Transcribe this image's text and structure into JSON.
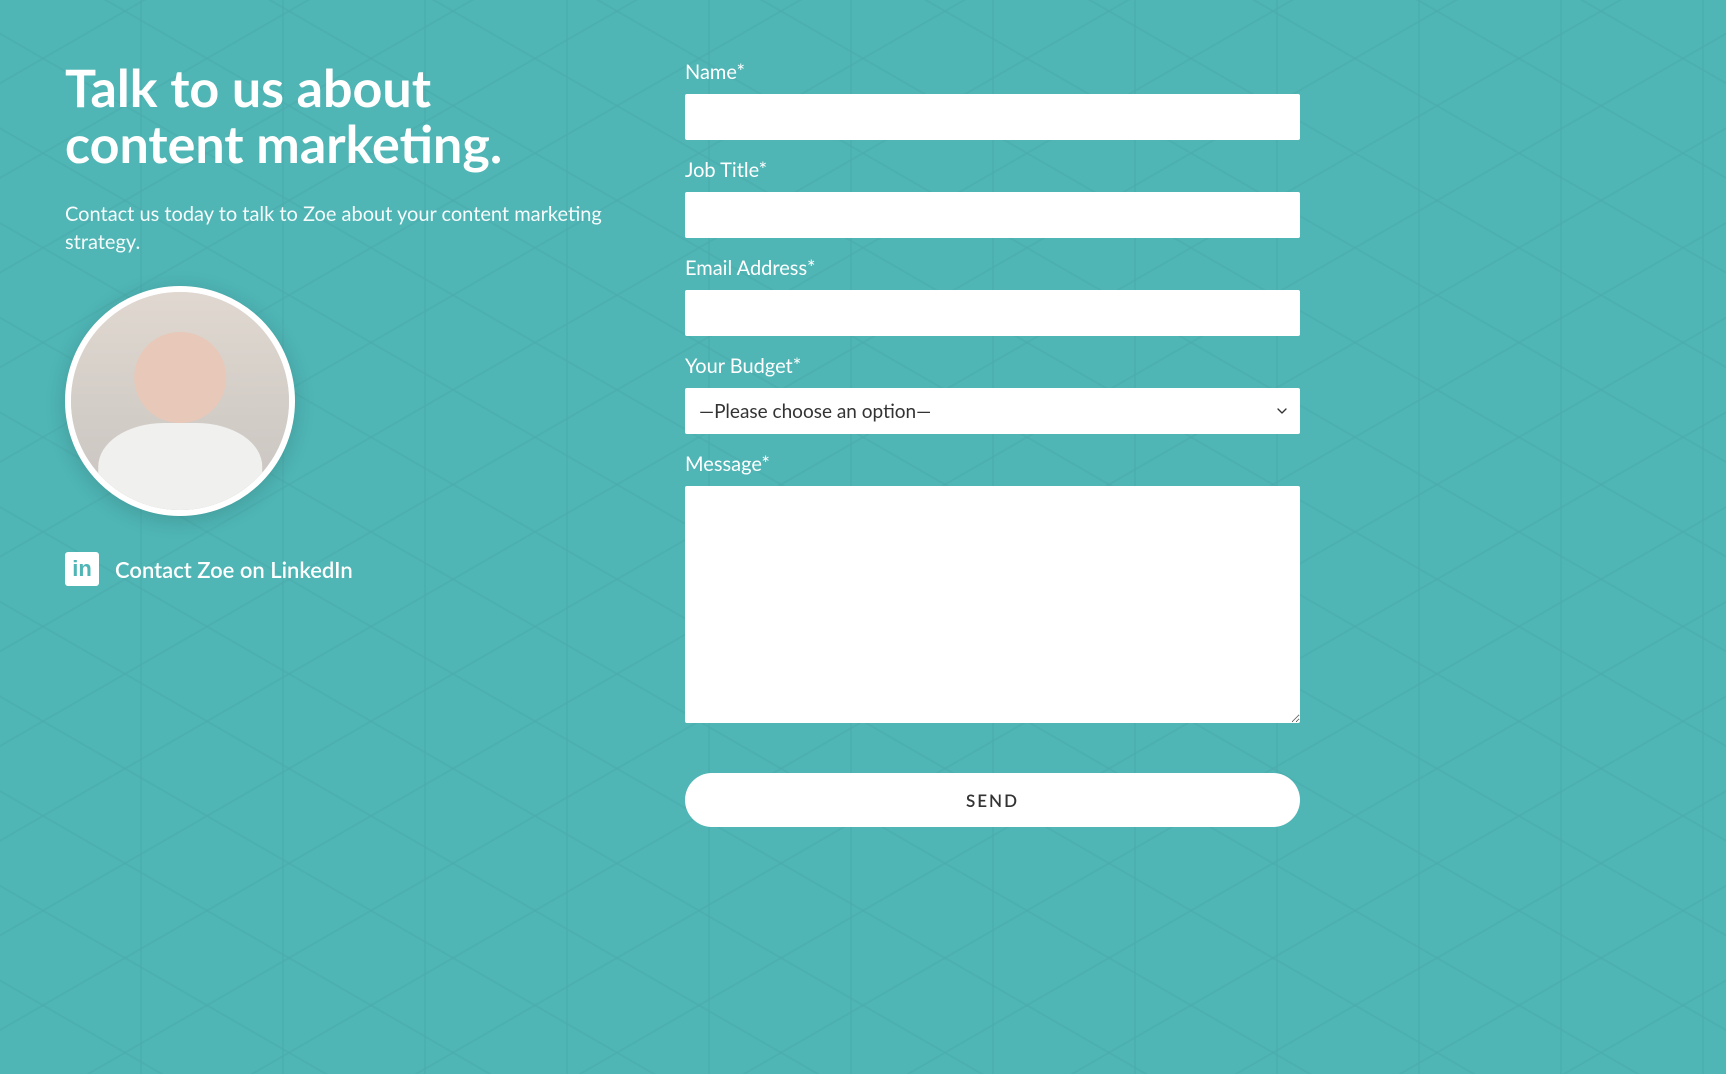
{
  "left": {
    "heading": "Talk to us about content marketing.",
    "subheading": "Contact us today to talk to Zoe about your content marketing strategy.",
    "linkedin_label": "Contact Zoe on LinkedIn"
  },
  "form": {
    "name_label": "Name*",
    "job_title_label": "Job Title*",
    "email_label": "Email Address*",
    "budget_label": "Your Budget*",
    "budget_placeholder": "—Please choose an option—",
    "message_label": "Message*",
    "submit_label": "SEND"
  }
}
